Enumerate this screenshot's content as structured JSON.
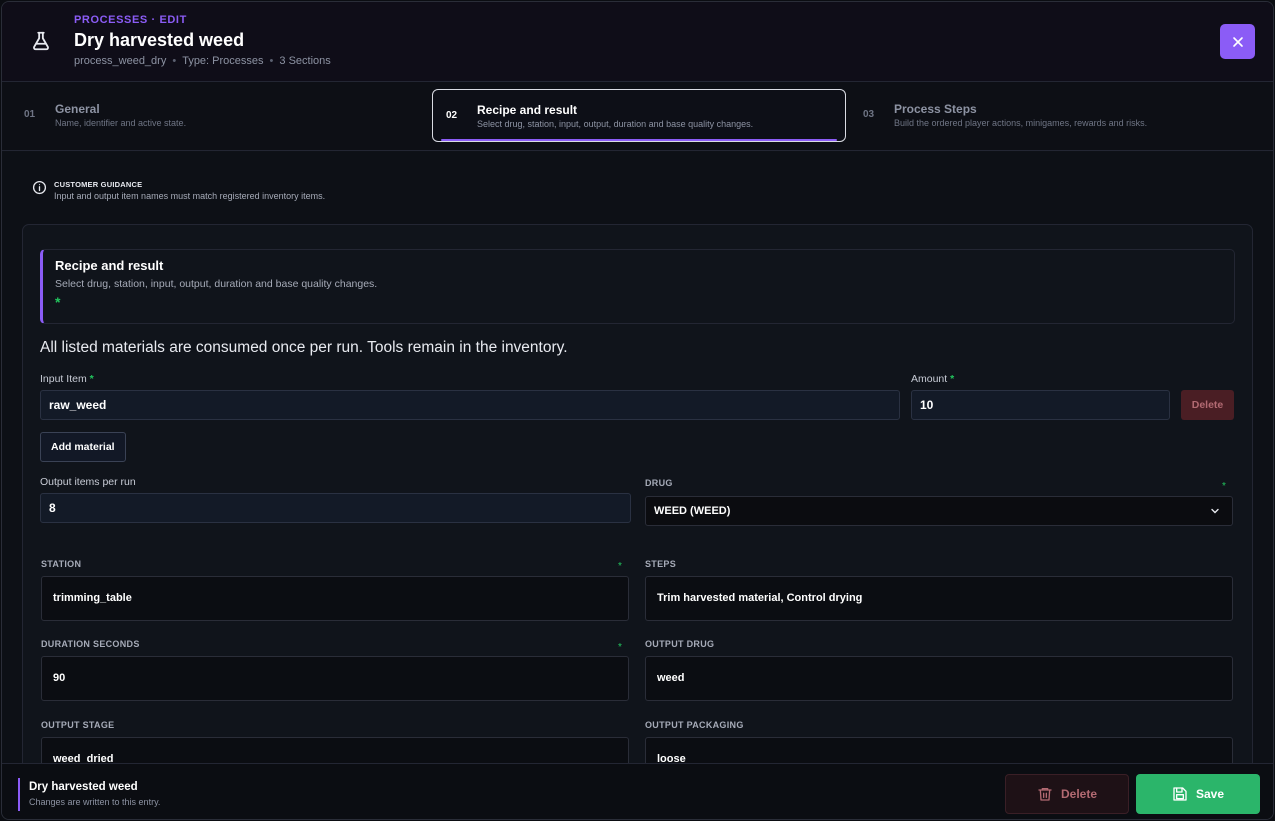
{
  "header": {
    "eyebrow": "PROCESSES · EDIT",
    "title": "Dry harvested weed",
    "meta": {
      "id": "process_weed_dry",
      "type": "Type: Processes",
      "sections": "3 Sections"
    }
  },
  "tabs": [
    {
      "num": "01",
      "name": "General",
      "desc": "Name, identifier and active state."
    },
    {
      "num": "02",
      "name": "Recipe and result",
      "desc": "Select drug, station, input, output, duration and base quality changes."
    },
    {
      "num": "03",
      "name": "Process Steps",
      "desc": "Build the ordered player actions, minigames, rewards and risks."
    }
  ],
  "guidance": {
    "label": "CUSTOMER GUIDANCE",
    "text": "Input and output item names must match registered inventory items."
  },
  "section": {
    "title": "Recipe and result",
    "desc": "Select drug, station, input, output, duration and base quality changes.",
    "asterisk": "*"
  },
  "note": "All listed materials are consumed once per run. Tools remain in the inventory.",
  "material": {
    "input_label": "Input Item",
    "input_value": "raw_weed",
    "amount_label": "Amount",
    "amount_value": "10",
    "delete_label": "Delete",
    "add_label": "Add material"
  },
  "output_per_run": {
    "label": "Output items per run",
    "value": "8"
  },
  "drug": {
    "label": "DRUG",
    "value": "WEED (WEED)"
  },
  "fields": {
    "station": {
      "label": "STATION",
      "value": "trimming_table"
    },
    "steps": {
      "label": "STEPS",
      "value": "Trim harvested material, Control drying"
    },
    "duration": {
      "label": "DURATION SECONDS",
      "value": "90"
    },
    "output_drug": {
      "label": "OUTPUT DRUG",
      "value": "weed"
    },
    "output_stage": {
      "label": "OUTPUT STAGE",
      "value": "weed_dried"
    },
    "output_packaging": {
      "label": "OUTPUT PACKAGING",
      "value": "loose"
    }
  },
  "required_mark": "*",
  "footer": {
    "title": "Dry harvested weed",
    "subtitle": "Changes are written to this entry.",
    "delete_label": "Delete",
    "save_label": "Save"
  },
  "colors": {
    "accent": "#8b5cf6",
    "success": "#2bb56a",
    "danger": "#4a1e24"
  },
  "icons": [
    "flask-icon",
    "close-icon",
    "info-icon",
    "chevron-down-icon",
    "trash-icon",
    "save-icon"
  ]
}
